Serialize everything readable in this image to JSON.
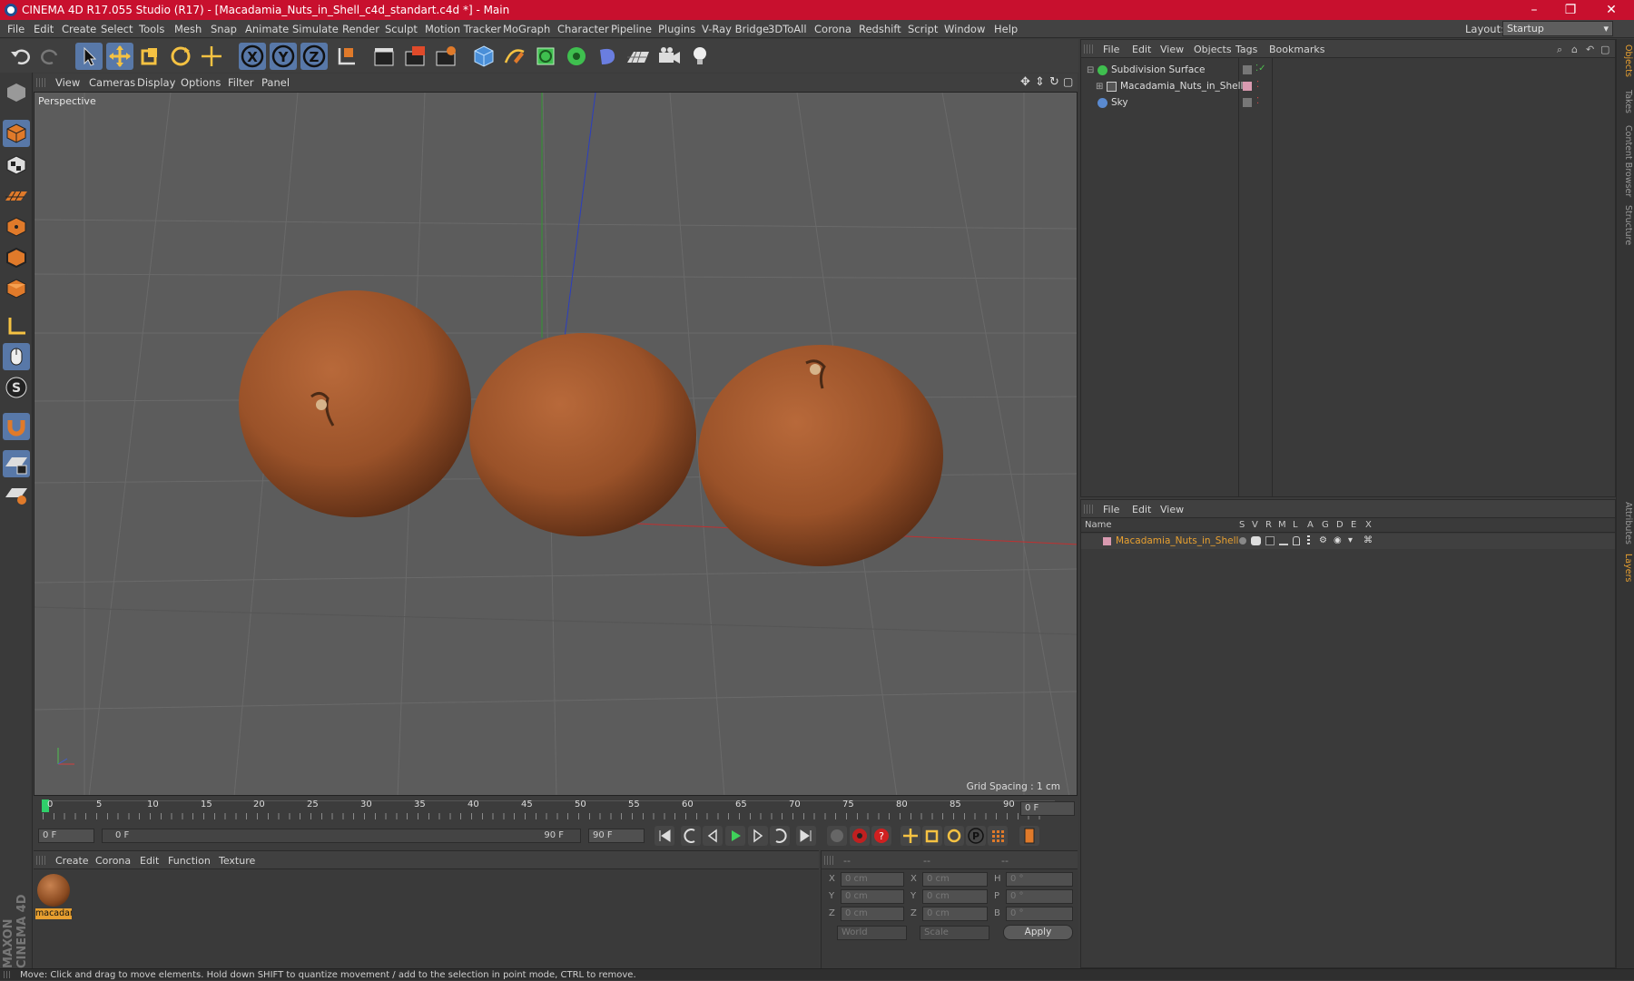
{
  "window": {
    "title": "CINEMA 4D R17.055 Studio (R17) - [Macadamia_Nuts_in_Shell_c4d_standart.c4d *] - Main",
    "minimize": "–",
    "maximize": "❐",
    "close": "✕"
  },
  "menubar": {
    "items": [
      "File",
      "Edit",
      "Create",
      "Select",
      "Tools",
      "Mesh",
      "Snap",
      "Animate",
      "Simulate",
      "Render",
      "Sculpt",
      "Motion Tracker",
      "MoGraph",
      "Character",
      "Pipeline",
      "Plugins",
      "V-Ray Bridge",
      "3DToAll",
      "Corona",
      "Redshift",
      "Script",
      "Window",
      "Help"
    ],
    "layout_label": "Layout:",
    "layout_value": "Startup"
  },
  "viewport": {
    "menu": [
      "View",
      "Cameras",
      "Display",
      "Options",
      "Filter",
      "Panel"
    ],
    "camera_label": "Perspective",
    "grid_spacing": "Grid Spacing : 1 cm"
  },
  "timeline": {
    "ticks": [
      "0",
      "5",
      "10",
      "15",
      "20",
      "25",
      "30",
      "35",
      "40",
      "45",
      "50",
      "55",
      "60",
      "65",
      "70",
      "75",
      "80",
      "85",
      "90"
    ],
    "current_frame": "0 F",
    "start_field": "0 F",
    "slider_left": "0 F",
    "slider_right": "90 F",
    "end_field": "90 F"
  },
  "material_panel": {
    "menu": [
      "Create",
      "Corona",
      "Edit",
      "Function",
      "Texture"
    ],
    "material_name": "macadar"
  },
  "coords": {
    "headers": [
      "--",
      "--",
      "--"
    ],
    "rows": [
      {
        "a": "X",
        "av": "0 cm",
        "b": "X",
        "bv": "0 cm",
        "c": "H",
        "cv": "0 °"
      },
      {
        "a": "Y",
        "av": "0 cm",
        "b": "Y",
        "bv": "0 cm",
        "c": "P",
        "cv": "0 °"
      },
      {
        "a": "Z",
        "av": "0 cm",
        "b": "Z",
        "bv": "0 cm",
        "c": "B",
        "cv": "0 °"
      }
    ],
    "world": "World",
    "scale": "Scale",
    "apply": "Apply"
  },
  "object_manager": {
    "menu": [
      "File",
      "Edit",
      "View",
      "Objects",
      "Tags",
      "Bookmarks"
    ],
    "objects": [
      {
        "name": "Subdivision Surface",
        "icon": "subdivision-icon"
      },
      {
        "name": "Macadamia_Nuts_in_Shell",
        "icon": "null-object-icon"
      },
      {
        "name": "Sky",
        "icon": "sky-icon"
      }
    ]
  },
  "layer_manager": {
    "menu": [
      "File",
      "Edit",
      "View"
    ],
    "columns": [
      "Name",
      "S",
      "V",
      "R",
      "M",
      "L",
      "A",
      "G",
      "D",
      "E",
      "X"
    ],
    "layers": [
      {
        "name": "Macadamia_Nuts_in_Shell",
        "color": "#e8a030"
      }
    ]
  },
  "right_tabs": [
    "Objects",
    "Takes",
    "Content Browser",
    "Structure",
    "Attributes",
    "Layers"
  ],
  "brand": "MAXON CINEMA 4D",
  "status": "Move: Click and drag to move elements. Hold down SHIFT to quantize movement / add to the selection in point mode, CTRL to remove.",
  "colors": {
    "accent": "#5878a8",
    "titlebar": "#c8102e",
    "layer_orange": "#e8a030",
    "nut": "#a0582e"
  }
}
